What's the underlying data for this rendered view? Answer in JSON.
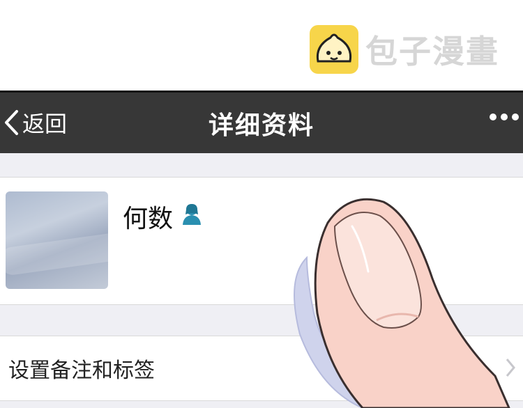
{
  "watermark": {
    "brand_text": "包子漫畫",
    "logo_icon": "bun-face-icon"
  },
  "navbar": {
    "back_label": "返回",
    "title": "详细资料",
    "more_icon": "more-dots-icon"
  },
  "profile": {
    "name": "何数",
    "gender_icon": "female-person-icon"
  },
  "remark_row": {
    "label": "设置备注和标签"
  },
  "colors": {
    "navbar_bg": "#373737",
    "page_bg": "#efeff4",
    "logo_bg": "#f7d54a"
  }
}
